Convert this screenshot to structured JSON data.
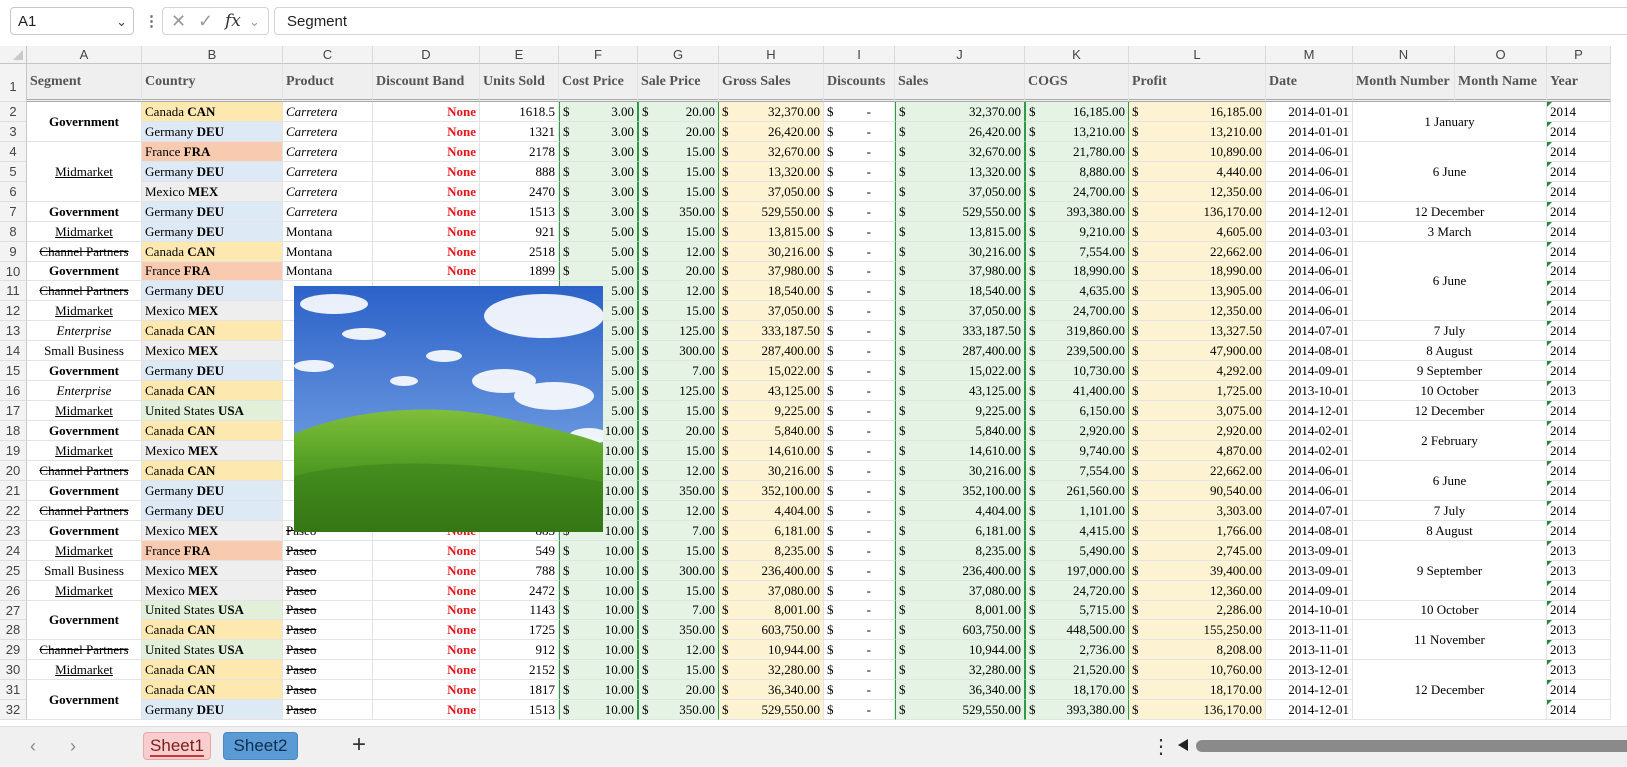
{
  "formula_bar": {
    "name_box": "A1",
    "formula": "Segment",
    "fx_label": "fx"
  },
  "columns": [
    "A",
    "B",
    "C",
    "D",
    "E",
    "F",
    "G",
    "H",
    "I",
    "J",
    "K",
    "L",
    "M",
    "N",
    "O",
    "P"
  ],
  "headers": [
    "Segment",
    "Country",
    "Product",
    "Discount Band",
    "Units Sold",
    "Cost Price",
    "Sale Price",
    "Gross Sales",
    "Discounts",
    "Sales",
    "COGS",
    "Profit",
    "Date",
    "Month Number",
    "Month Name",
    "Year"
  ],
  "rows": [
    {
      "country": "Canada",
      "code": "CAN",
      "product": "Carretera",
      "discount": "None",
      "units": "1618.5",
      "cost": "3.00",
      "price": "20.00",
      "gross": "32,370.00",
      "disc": "-",
      "sales": "32,370.00",
      "cogs": "16,185.00",
      "profit": "16,185.00",
      "date": "2014-01-01",
      "year": "2014"
    },
    {
      "country": "Germany",
      "code": "DEU",
      "product": "Carretera",
      "discount": "None",
      "units": "1321",
      "cost": "3.00",
      "price": "20.00",
      "gross": "26,420.00",
      "disc": "-",
      "sales": "26,420.00",
      "cogs": "13,210.00",
      "profit": "13,210.00",
      "date": "2014-01-01",
      "year": "2014"
    },
    {
      "country": "France",
      "code": "FRA",
      "product": "Carretera",
      "discount": "None",
      "units": "2178",
      "cost": "3.00",
      "price": "15.00",
      "gross": "32,670.00",
      "disc": "-",
      "sales": "32,670.00",
      "cogs": "21,780.00",
      "profit": "10,890.00",
      "date": "2014-06-01",
      "year": "2014"
    },
    {
      "country": "Germany",
      "code": "DEU",
      "product": "Carretera",
      "discount": "None",
      "units": "888",
      "cost": "3.00",
      "price": "15.00",
      "gross": "13,320.00",
      "disc": "-",
      "sales": "13,320.00",
      "cogs": "8,880.00",
      "profit": "4,440.00",
      "date": "2014-06-01",
      "year": "2014"
    },
    {
      "country": "Mexico",
      "code": "MEX",
      "product": "Carretera",
      "discount": "None",
      "units": "2470",
      "cost": "3.00",
      "price": "15.00",
      "gross": "37,050.00",
      "disc": "-",
      "sales": "37,050.00",
      "cogs": "24,700.00",
      "profit": "12,350.00",
      "date": "2014-06-01",
      "year": "2014"
    },
    {
      "country": "Germany",
      "code": "DEU",
      "product": "Carretera",
      "discount": "None",
      "units": "1513",
      "cost": "3.00",
      "price": "350.00",
      "gross": "529,550.00",
      "disc": "-",
      "sales": "529,550.00",
      "cogs": "393,380.00",
      "profit": "136,170.00",
      "date": "2014-12-01",
      "year": "2014"
    },
    {
      "country": "Germany",
      "code": "DEU",
      "product": "Montana",
      "discount": "None",
      "units": "921",
      "cost": "5.00",
      "price": "15.00",
      "gross": "13,815.00",
      "disc": "-",
      "sales": "13,815.00",
      "cogs": "9,210.00",
      "profit": "4,605.00",
      "date": "2014-03-01",
      "year": "2014"
    },
    {
      "country": "Canada",
      "code": "CAN",
      "product": "Montana",
      "discount": "None",
      "units": "2518",
      "cost": "5.00",
      "price": "12.00",
      "gross": "30,216.00",
      "disc": "-",
      "sales": "30,216.00",
      "cogs": "7,554.00",
      "profit": "22,662.00",
      "date": "2014-06-01",
      "year": "2014"
    },
    {
      "country": "France",
      "code": "FRA",
      "product": "Montana",
      "discount": "None",
      "units": "1899",
      "cost": "5.00",
      "price": "20.00",
      "gross": "37,980.00",
      "disc": "-",
      "sales": "37,980.00",
      "cogs": "18,990.00",
      "profit": "18,990.00",
      "date": "2014-06-01",
      "year": "2014"
    },
    {
      "country": "Germany",
      "code": "DEU",
      "product": "",
      "discount": "",
      "units": "",
      "cost": "5.00",
      "price": "12.00",
      "gross": "18,540.00",
      "disc": "-",
      "sales": "18,540.00",
      "cogs": "4,635.00",
      "profit": "13,905.00",
      "date": "2014-06-01",
      "year": "2014"
    },
    {
      "country": "Mexico",
      "code": "MEX",
      "product": "",
      "discount": "",
      "units": "",
      "cost": "5.00",
      "price": "15.00",
      "gross": "37,050.00",
      "disc": "-",
      "sales": "37,050.00",
      "cogs": "24,700.00",
      "profit": "12,350.00",
      "date": "2014-06-01",
      "year": "2014"
    },
    {
      "country": "Canada",
      "code": "CAN",
      "product": "",
      "discount": "",
      "units": "",
      "cost": "5.00",
      "price": "125.00",
      "gross": "333,187.50",
      "disc": "-",
      "sales": "333,187.50",
      "cogs": "319,860.00",
      "profit": "13,327.50",
      "date": "2014-07-01",
      "year": "2014"
    },
    {
      "country": "Mexico",
      "code": "MEX",
      "product": "",
      "discount": "",
      "units": "",
      "cost": "5.00",
      "price": "300.00",
      "gross": "287,400.00",
      "disc": "-",
      "sales": "287,400.00",
      "cogs": "239,500.00",
      "profit": "47,900.00",
      "date": "2014-08-01",
      "year": "2014"
    },
    {
      "country": "Germany",
      "code": "DEU",
      "product": "",
      "discount": "",
      "units": "",
      "cost": "5.00",
      "price": "7.00",
      "gross": "15,022.00",
      "disc": "-",
      "sales": "15,022.00",
      "cogs": "10,730.00",
      "profit": "4,292.00",
      "date": "2014-09-01",
      "year": "2014"
    },
    {
      "country": "Canada",
      "code": "CAN",
      "product": "",
      "discount": "",
      "units": "",
      "cost": "5.00",
      "price": "125.00",
      "gross": "43,125.00",
      "disc": "-",
      "sales": "43,125.00",
      "cogs": "41,400.00",
      "profit": "1,725.00",
      "date": "2013-10-01",
      "year": "2013"
    },
    {
      "country": "United States",
      "code": "USA",
      "product": "",
      "discount": "",
      "units": "",
      "cost": "5.00",
      "price": "15.00",
      "gross": "9,225.00",
      "disc": "-",
      "sales": "9,225.00",
      "cogs": "6,150.00",
      "profit": "3,075.00",
      "date": "2014-12-01",
      "year": "2014"
    },
    {
      "country": "Canada",
      "code": "CAN",
      "product": "",
      "discount": "",
      "units": "",
      "cost": "10.00",
      "price": "20.00",
      "gross": "5,840.00",
      "disc": "-",
      "sales": "5,840.00",
      "cogs": "2,920.00",
      "profit": "2,920.00",
      "date": "2014-02-01",
      "year": "2014"
    },
    {
      "country": "Mexico",
      "code": "MEX",
      "product": "",
      "discount": "",
      "units": "",
      "cost": "10.00",
      "price": "15.00",
      "gross": "14,610.00",
      "disc": "-",
      "sales": "14,610.00",
      "cogs": "9,740.00",
      "profit": "4,870.00",
      "date": "2014-02-01",
      "year": "2014"
    },
    {
      "country": "Canada",
      "code": "CAN",
      "product": "",
      "discount": "",
      "units": "",
      "cost": "10.00",
      "price": "12.00",
      "gross": "30,216.00",
      "disc": "-",
      "sales": "30,216.00",
      "cogs": "7,554.00",
      "profit": "22,662.00",
      "date": "2014-06-01",
      "year": "2014"
    },
    {
      "country": "Germany",
      "code": "DEU",
      "product": "",
      "discount": "",
      "units": "",
      "cost": "10.00",
      "price": "350.00",
      "gross": "352,100.00",
      "disc": "-",
      "sales": "352,100.00",
      "cogs": "261,560.00",
      "profit": "90,540.00",
      "date": "2014-06-01",
      "year": "2014"
    },
    {
      "country": "Germany",
      "code": "DEU",
      "product": "",
      "discount": "",
      "units": "",
      "cost": "10.00",
      "price": "12.00",
      "gross": "4,404.00",
      "disc": "-",
      "sales": "4,404.00",
      "cogs": "1,101.00",
      "profit": "3,303.00",
      "date": "2014-07-01",
      "year": "2014"
    },
    {
      "country": "Mexico",
      "code": "MEX",
      "product": "Paseo",
      "discount": "None",
      "units": "883",
      "cost": "10.00",
      "price": "7.00",
      "gross": "6,181.00",
      "disc": "-",
      "sales": "6,181.00",
      "cogs": "4,415.00",
      "profit": "1,766.00",
      "date": "2014-08-01",
      "year": "2014"
    },
    {
      "country": "France",
      "code": "FRA",
      "product": "Paseo",
      "discount": "None",
      "units": "549",
      "cost": "10.00",
      "price": "15.00",
      "gross": "8,235.00",
      "disc": "-",
      "sales": "8,235.00",
      "cogs": "5,490.00",
      "profit": "2,745.00",
      "date": "2013-09-01",
      "year": "2013"
    },
    {
      "country": "Mexico",
      "code": "MEX",
      "product": "Paseo",
      "discount": "None",
      "units": "788",
      "cost": "10.00",
      "price": "300.00",
      "gross": "236,400.00",
      "disc": "-",
      "sales": "236,400.00",
      "cogs": "197,000.00",
      "profit": "39,400.00",
      "date": "2013-09-01",
      "year": "2013"
    },
    {
      "country": "Mexico",
      "code": "MEX",
      "product": "Paseo",
      "discount": "None",
      "units": "2472",
      "cost": "10.00",
      "price": "15.00",
      "gross": "37,080.00",
      "disc": "-",
      "sales": "37,080.00",
      "cogs": "24,720.00",
      "profit": "12,360.00",
      "date": "2014-09-01",
      "year": "2014"
    },
    {
      "country": "United States",
      "code": "USA",
      "product": "Paseo",
      "discount": "None",
      "units": "1143",
      "cost": "10.00",
      "price": "7.00",
      "gross": "8,001.00",
      "disc": "-",
      "sales": "8,001.00",
      "cogs": "5,715.00",
      "profit": "2,286.00",
      "date": "2014-10-01",
      "year": "2014"
    },
    {
      "country": "Canada",
      "code": "CAN",
      "product": "Paseo",
      "discount": "None",
      "units": "1725",
      "cost": "10.00",
      "price": "350.00",
      "gross": "603,750.00",
      "disc": "-",
      "sales": "603,750.00",
      "cogs": "448,500.00",
      "profit": "155,250.00",
      "date": "2013-11-01",
      "year": "2013"
    },
    {
      "country": "United States",
      "code": "USA",
      "product": "Paseo",
      "discount": "None",
      "units": "912",
      "cost": "10.00",
      "price": "12.00",
      "gross": "10,944.00",
      "disc": "-",
      "sales": "10,944.00",
      "cogs": "2,736.00",
      "profit": "8,208.00",
      "date": "2013-11-01",
      "year": "2013"
    },
    {
      "country": "Canada",
      "code": "CAN",
      "product": "Paseo",
      "discount": "None",
      "units": "2152",
      "cost": "10.00",
      "price": "15.00",
      "gross": "32,280.00",
      "disc": "-",
      "sales": "32,280.00",
      "cogs": "21,520.00",
      "profit": "10,760.00",
      "date": "2013-12-01",
      "year": "2013"
    },
    {
      "country": "Canada",
      "code": "CAN",
      "product": "Paseo",
      "discount": "None",
      "units": "1817",
      "cost": "10.00",
      "price": "20.00",
      "gross": "36,340.00",
      "disc": "-",
      "sales": "36,340.00",
      "cogs": "18,170.00",
      "profit": "18,170.00",
      "date": "2014-12-01",
      "year": "2014"
    },
    {
      "country": "Germany",
      "code": "DEU",
      "product": "Paseo",
      "discount": "None",
      "units": "1513",
      "cost": "10.00",
      "price": "350.00",
      "gross": "529,550.00",
      "disc": "-",
      "sales": "529,550.00",
      "cogs": "393,380.00",
      "profit": "136,170.00",
      "date": "2014-12-01",
      "year": "2014"
    }
  ],
  "segments": [
    {
      "text": "Government",
      "style": "b",
      "from": 0,
      "to": 1
    },
    {
      "text": "Midmarket",
      "style": "u",
      "from": 2,
      "to": 4
    },
    {
      "text": "Government",
      "style": "b",
      "from": 5,
      "to": 5
    },
    {
      "text": "Midmarket",
      "style": "u",
      "from": 6,
      "to": 6
    },
    {
      "text": "Channel Partners",
      "style": "s",
      "from": 7,
      "to": 7
    },
    {
      "text": "Government",
      "style": "b",
      "from": 8,
      "to": 8
    },
    {
      "text": "Channel Partners",
      "style": "s",
      "from": 9,
      "to": 9
    },
    {
      "text": "Midmarket",
      "style": "u",
      "from": 10,
      "to": 10
    },
    {
      "text": "Enterprise",
      "style": "i",
      "from": 11,
      "to": 11
    },
    {
      "text": "Small Business",
      "style": "",
      "from": 12,
      "to": 12
    },
    {
      "text": "Government",
      "style": "b",
      "from": 13,
      "to": 13
    },
    {
      "text": "Enterprise",
      "style": "i",
      "from": 14,
      "to": 14
    },
    {
      "text": "Midmarket",
      "style": "u",
      "from": 15,
      "to": 15
    },
    {
      "text": "Government",
      "style": "b",
      "from": 16,
      "to": 16
    },
    {
      "text": "Midmarket",
      "style": "u",
      "from": 17,
      "to": 17
    },
    {
      "text": "Channel Partners",
      "style": "s",
      "from": 18,
      "to": 18
    },
    {
      "text": "Government",
      "style": "b",
      "from": 19,
      "to": 19
    },
    {
      "text": "Channel Partners",
      "style": "s",
      "from": 20,
      "to": 20
    },
    {
      "text": "Government",
      "style": "b",
      "from": 21,
      "to": 21
    },
    {
      "text": "Midmarket",
      "style": "u",
      "from": 22,
      "to": 22
    },
    {
      "text": "Small Business",
      "style": "",
      "from": 23,
      "to": 23
    },
    {
      "text": "Midmarket",
      "style": "u",
      "from": 24,
      "to": 24
    },
    {
      "text": "Government",
      "style": "b",
      "from": 25,
      "to": 26
    },
    {
      "text": "Channel Partners",
      "style": "s",
      "from": 27,
      "to": 27
    },
    {
      "text": "Midmarket",
      "style": "u",
      "from": 28,
      "to": 28
    },
    {
      "text": "Government",
      "style": "b",
      "from": 29,
      "to": 30
    }
  ],
  "months": [
    {
      "text": "1 January",
      "from": 0,
      "to": 1
    },
    {
      "text": "6 June",
      "from": 2,
      "to": 4
    },
    {
      "text": "12 December",
      "from": 5,
      "to": 5
    },
    {
      "text": "3 March",
      "from": 6,
      "to": 6
    },
    {
      "text": "6 June",
      "from": 7,
      "to": 10
    },
    {
      "text": "7 July",
      "from": 11,
      "to": 11
    },
    {
      "text": "8 August",
      "from": 12,
      "to": 12
    },
    {
      "text": "9 September",
      "from": 13,
      "to": 13
    },
    {
      "text": "10 October",
      "from": 14,
      "to": 14
    },
    {
      "text": "12 December",
      "from": 15,
      "to": 15
    },
    {
      "text": "2 February",
      "from": 16,
      "to": 17
    },
    {
      "text": "6 June",
      "from": 18,
      "to": 19
    },
    {
      "text": "7 July",
      "from": 20,
      "to": 20
    },
    {
      "text": "8 August",
      "from": 21,
      "to": 21
    },
    {
      "text": "9 September",
      "from": 22,
      "to": 24
    },
    {
      "text": "10 October",
      "from": 25,
      "to": 25
    },
    {
      "text": "11 November",
      "from": 26,
      "to": 27
    },
    {
      "text": "12 December",
      "from": 28,
      "to": 30
    }
  ],
  "country_colors": {
    "CAN": "#fde8b0",
    "DEU": "#dde9f5",
    "FRA": "#f8cbb0",
    "MEX": "#eeeeee",
    "USA": "#e2f0d9"
  },
  "currency_symbol": "$",
  "sheets": [
    {
      "label": "Sheet1",
      "active": true
    },
    {
      "label": "Sheet2",
      "active": false
    }
  ],
  "add_sheet": "+",
  "more_menu": "⋮"
}
